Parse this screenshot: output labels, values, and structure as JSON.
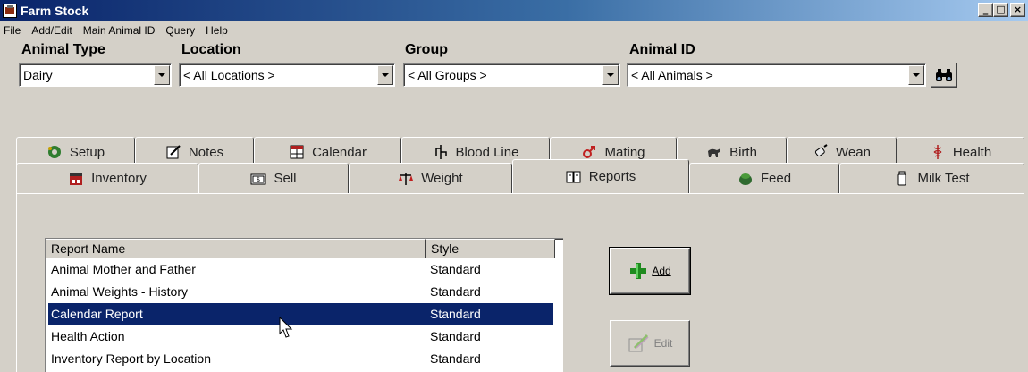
{
  "window": {
    "title": "Farm Stock"
  },
  "menu": [
    "File",
    "Add/Edit",
    "Main Animal ID",
    "Query",
    "Help"
  ],
  "filters": {
    "animal_type": {
      "label": "Animal Type",
      "value": "Dairy"
    },
    "location": {
      "label": "Location",
      "value": "< All Locations >"
    },
    "group": {
      "label": "Group",
      "value": "< All Groups >"
    },
    "animal_id": {
      "label": "Animal ID",
      "value": "< All Animals >"
    }
  },
  "tabs_top": [
    {
      "label": "Setup",
      "icon": "gear-icon"
    },
    {
      "label": "Notes",
      "icon": "notepad-icon"
    },
    {
      "label": "Calendar",
      "icon": "calendar-icon"
    },
    {
      "label": "Blood Line",
      "icon": "bloodline-icon"
    },
    {
      "label": "Mating",
      "icon": "gender-icon"
    },
    {
      "label": "Birth",
      "icon": "calf-icon"
    },
    {
      "label": "Wean",
      "icon": "bottle-icon"
    },
    {
      "label": "Health",
      "icon": "caduceus-icon"
    }
  ],
  "tabs_bottom": [
    {
      "label": "Inventory",
      "icon": "barn-icon"
    },
    {
      "label": "Sell",
      "icon": "money-icon"
    },
    {
      "label": "Weight",
      "icon": "scale-icon"
    },
    {
      "label": "Reports",
      "icon": "report-icon",
      "active": true
    },
    {
      "label": "Feed",
      "icon": "feed-icon"
    },
    {
      "label": "Milk Test",
      "icon": "milk-icon"
    }
  ],
  "report_list": {
    "columns": [
      "Report Name",
      "Style"
    ],
    "rows": [
      {
        "name": "Animal Mother and Father",
        "style": "Standard"
      },
      {
        "name": "Animal Weights - History",
        "style": "Standard"
      },
      {
        "name": "Calendar Report",
        "style": "Standard",
        "selected": true
      },
      {
        "name": "Health Action",
        "style": "Standard"
      },
      {
        "name": "Inventory Report by Location",
        "style": "Standard"
      }
    ]
  },
  "actions": {
    "add": {
      "label": "Add",
      "icon": "plus-icon"
    },
    "edit": {
      "label": "Edit",
      "icon": "edit-icon",
      "enabled": false
    }
  },
  "colors": {
    "face": "#d4d0c8",
    "selection": "#0a246a",
    "title_start": "#0a246a",
    "title_end": "#a6caf0"
  }
}
